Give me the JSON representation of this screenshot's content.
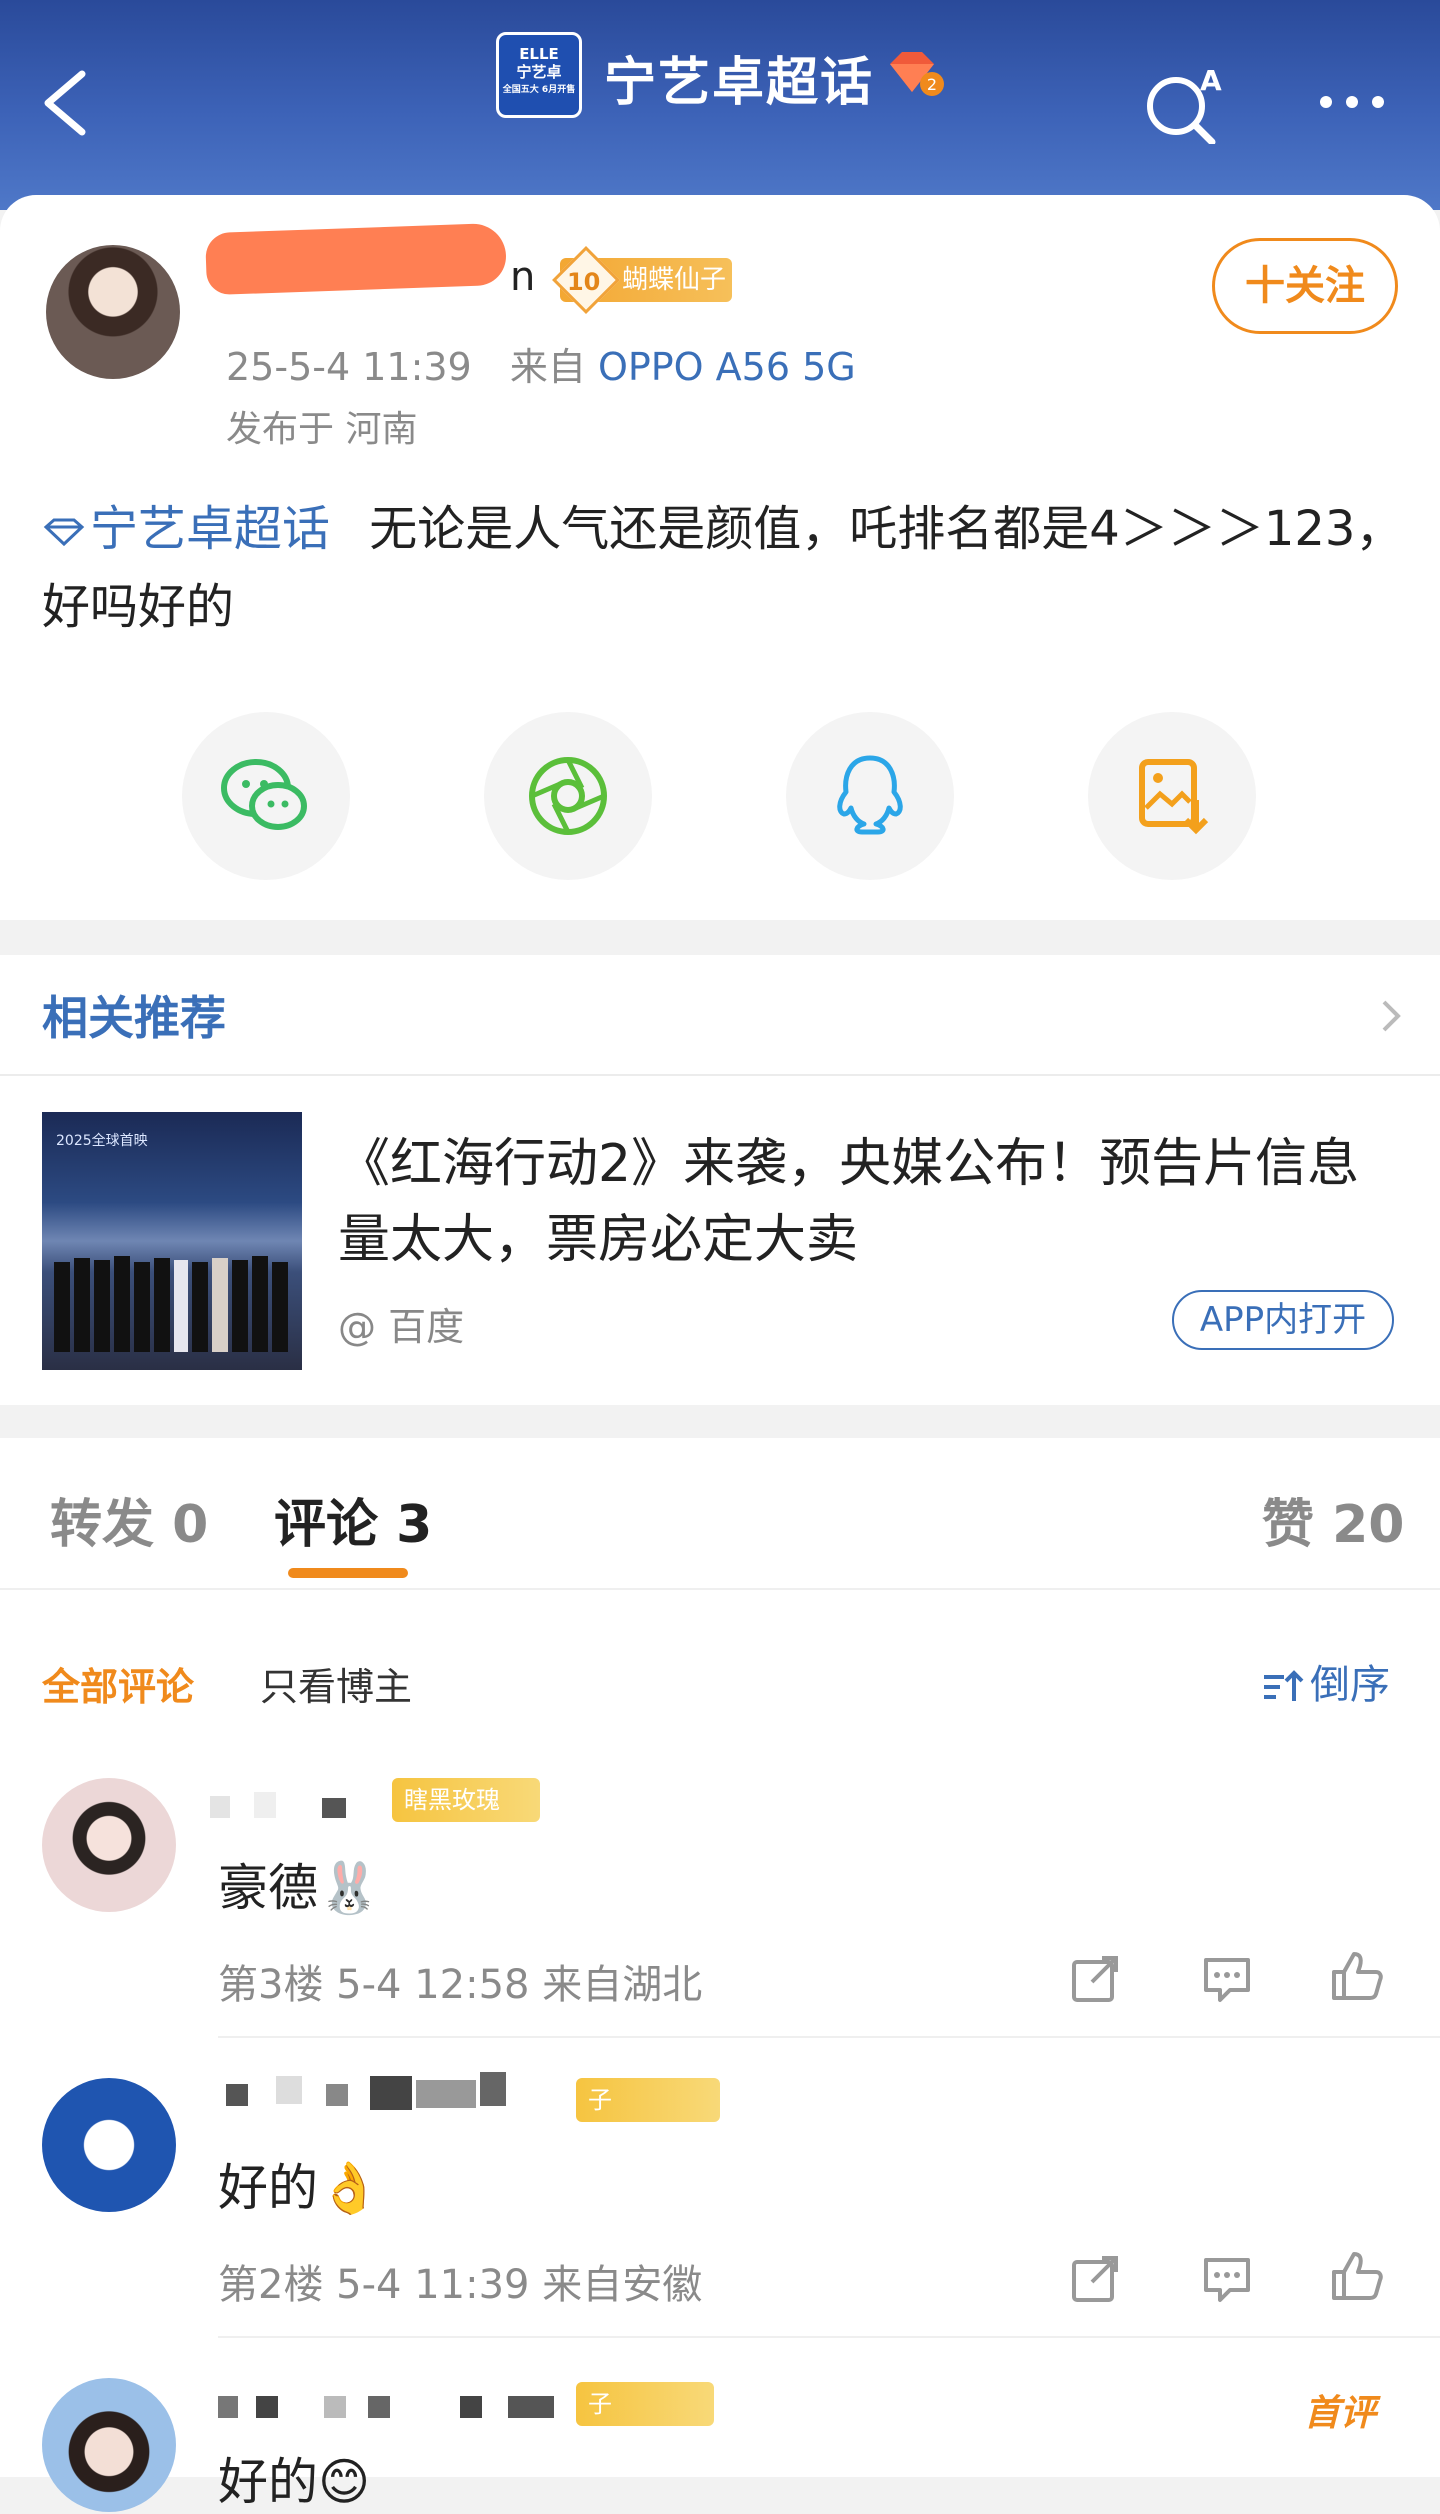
{
  "header": {
    "topic_title": "宁艺卓超话",
    "topic_logo_lines": [
      "ELLE",
      "宁艺卓",
      "全国五大 6月开售"
    ],
    "gem_level": "2",
    "ai_label": "AI"
  },
  "post": {
    "username_suffix": "n",
    "level": "10",
    "badge_label": "蝴蝶仙子",
    "time": "25-5-4 11:39",
    "from_prefix": "来自",
    "device": "OPPO A56 5G",
    "location": "发布于 河南",
    "follow_label": "十关注",
    "topic_link": "宁艺卓超话",
    "text": "无论是人气还是颜值，吒排名都是4＞＞＞123，好吗好的"
  },
  "share": {
    "icons": [
      "wechat-icon",
      "moments-icon",
      "qq-icon",
      "save-image-icon"
    ]
  },
  "related": {
    "title": "相关推荐",
    "thumb_caption": "2025全球首映",
    "headline": "《红海行动2》来袭，央媒公布！预告片信息量太大，票房必定大卖",
    "source": "@ 百度",
    "open_label": "APP内打开"
  },
  "tabs": {
    "repost": "转发 0",
    "comment": "评论 3",
    "likes": "赞 20"
  },
  "filters": {
    "all": "全部评论",
    "author": "只看博主",
    "sort": "倒序"
  },
  "comments": [
    {
      "badge": "瞎黑玫瑰",
      "text": "豪德🐰",
      "meta": "第3楼 5-4 12:58 来自湖北"
    },
    {
      "badge": "子",
      "text": "好的👌",
      "meta": "第2楼 5-4 11:39 来自安徽"
    },
    {
      "badge": "子",
      "text": "好的😊",
      "tag": "首评"
    }
  ],
  "colors": {
    "header": "#3d63b8",
    "accent": "#f08a1c",
    "link": "#3a6fb8"
  }
}
